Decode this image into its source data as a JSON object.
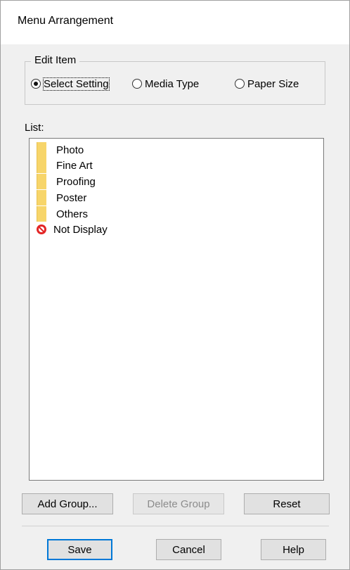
{
  "window": {
    "title": "Menu Arrangement"
  },
  "edit_item": {
    "legend": "Edit Item",
    "options": [
      {
        "label": "Select Setting",
        "checked": true
      },
      {
        "label": "Media Type",
        "checked": false
      },
      {
        "label": "Paper Size",
        "checked": false
      }
    ]
  },
  "list": {
    "label": "List:",
    "items": [
      {
        "label": "Photo",
        "icon": "folder-icon"
      },
      {
        "label": "Fine Art",
        "icon": "folder-icon"
      },
      {
        "label": "Proofing",
        "icon": "folder-icon"
      },
      {
        "label": "Poster",
        "icon": "folder-icon"
      },
      {
        "label": "Others",
        "icon": "folder-icon"
      },
      {
        "label": "Not Display",
        "icon": "no-entry-icon"
      }
    ]
  },
  "buttons": {
    "add_group": "Add Group...",
    "delete_group": "Delete Group",
    "reset": "Reset",
    "save": "Save",
    "cancel": "Cancel",
    "help": "Help"
  },
  "colors": {
    "folder": "#f7d56a",
    "no_entry": "#e32626",
    "default_button_border": "#0078d7"
  }
}
